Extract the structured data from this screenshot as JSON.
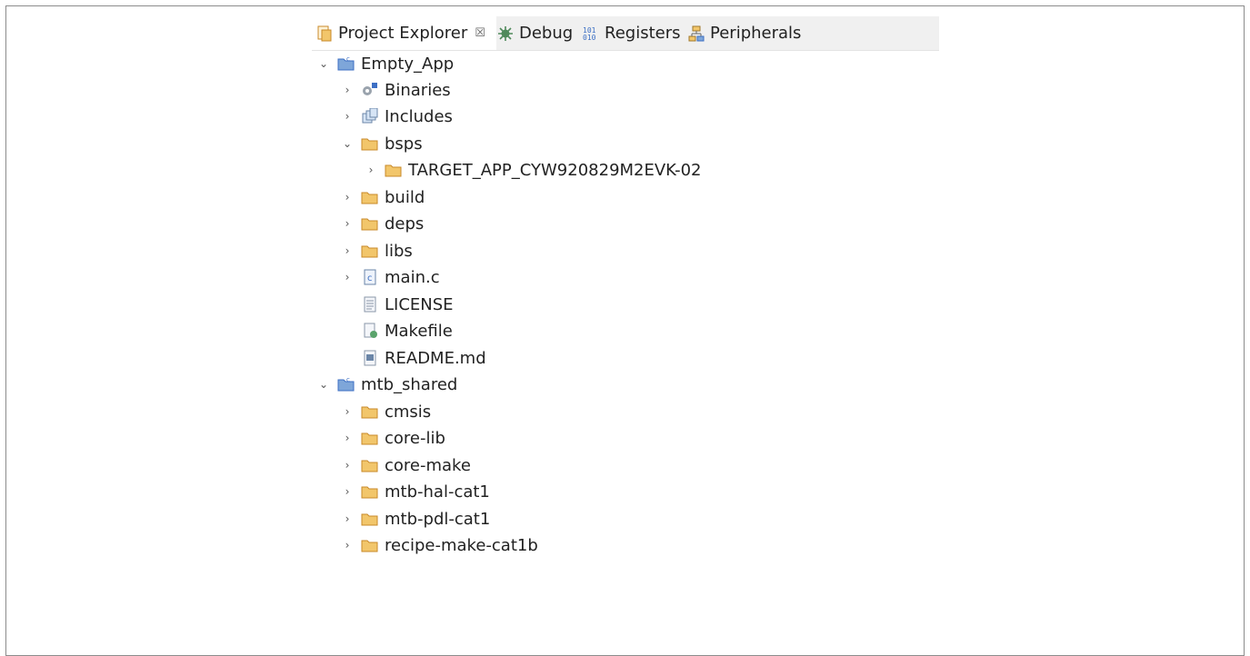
{
  "tabs": [
    {
      "label": "Project Explorer",
      "icon": "project-explorer-icon",
      "close": "☒"
    },
    {
      "label": "Debug",
      "icon": "debug-bug-icon"
    },
    {
      "label": "Registers",
      "icon": "registers-icon"
    },
    {
      "label": "Peripherals",
      "icon": "peripherals-icon"
    }
  ],
  "tree": {
    "projects": [
      {
        "name": "Empty_App",
        "children": [
          {
            "name": "Binaries",
            "icon": "binaries-icon"
          },
          {
            "name": "Includes",
            "icon": "includes-icon"
          },
          {
            "name": "bsps",
            "icon": "folder-icon",
            "children": [
              {
                "name": "TARGET_APP_CYW920829M2EVK-02",
                "icon": "folder-icon"
              }
            ]
          },
          {
            "name": "build",
            "icon": "folder-icon"
          },
          {
            "name": "deps",
            "icon": "folder-icon"
          },
          {
            "name": "libs",
            "icon": "folder-icon"
          },
          {
            "name": "main.c",
            "icon": "c-file-icon"
          },
          {
            "name": "LICENSE",
            "icon": "text-file-icon"
          },
          {
            "name": "Makefile",
            "icon": "makefile-icon"
          },
          {
            "name": "README.md",
            "icon": "markdown-file-icon"
          }
        ]
      },
      {
        "name": "mtb_shared",
        "children": [
          {
            "name": "cmsis",
            "icon": "folder-icon"
          },
          {
            "name": "core-lib",
            "icon": "folder-icon"
          },
          {
            "name": "core-make",
            "icon": "folder-icon"
          },
          {
            "name": "mtb-hal-cat1",
            "icon": "folder-icon"
          },
          {
            "name": "mtb-pdl-cat1",
            "icon": "folder-icon"
          },
          {
            "name": "recipe-make-cat1b",
            "icon": "folder-icon"
          }
        ]
      }
    ]
  },
  "colors": {
    "folder": "#f2c66b",
    "folder_stroke": "#c88a2a",
    "project_blue": "#4a78c2"
  }
}
